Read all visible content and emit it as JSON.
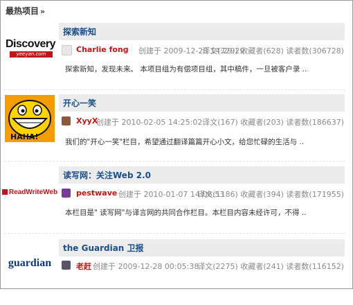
{
  "section_title": "最热项目",
  "section_arrows": "»",
  "projects": [
    {
      "logo_icon": "discovery-logo",
      "logo_text": "Discovery",
      "logo_subtext": "yeeyan.com",
      "title": "探索新知",
      "user": "Charlie fong",
      "created": "创建于 2009-12-28 14:29:29",
      "stats": "译文(729) 收藏者(628) 读者数(306728)",
      "desc": "探索新知，发现未来。 本项目组为有偿项目组，其中稿件，一旦被客户录 .."
    },
    {
      "logo_icon": "laughing-face-logo",
      "logo_text": "",
      "logo_subtext": "",
      "title": "开心一笑",
      "user": "XyyX",
      "created": "创建于 2010-02-05 14:25:02",
      "stats": "译文(167) 收藏者(203) 读者数(186637)",
      "desc": "我们的\"开心一笑\"栏目，希望通过翻译篇篇开心小文，给您忙碌的生活与 .."
    },
    {
      "logo_icon": "readwriteweb-logo",
      "logo_text": "ReadWriteWeb",
      "logo_subtext": "",
      "title": "读写网：关注Web 2.0",
      "user": "pestwave",
      "created": "创建于 2010-01-07 14:06:53",
      "stats": "译文(1186) 收藏者(394) 读者数(171955)",
      "desc": "本栏目是\" 读写网\"与译言网的共同合作栏目。本栏目内容未经许可，不得 .."
    },
    {
      "logo_icon": "guardian-logo",
      "logo_text": "guardian",
      "logo_subtext": "",
      "title": "the Guardian 卫报",
      "user": "老赶",
      "created": "创建于 2009-12-28 00:05:38",
      "stats": "译文(2275) 收藏者(241) 读者数(116152)",
      "desc": ""
    }
  ],
  "colors": {
    "title_link": "#1a4e8a",
    "user_link": "#cc1111",
    "meta_gray": "#8a8a8a",
    "title_bar_bg": "#ececec"
  }
}
